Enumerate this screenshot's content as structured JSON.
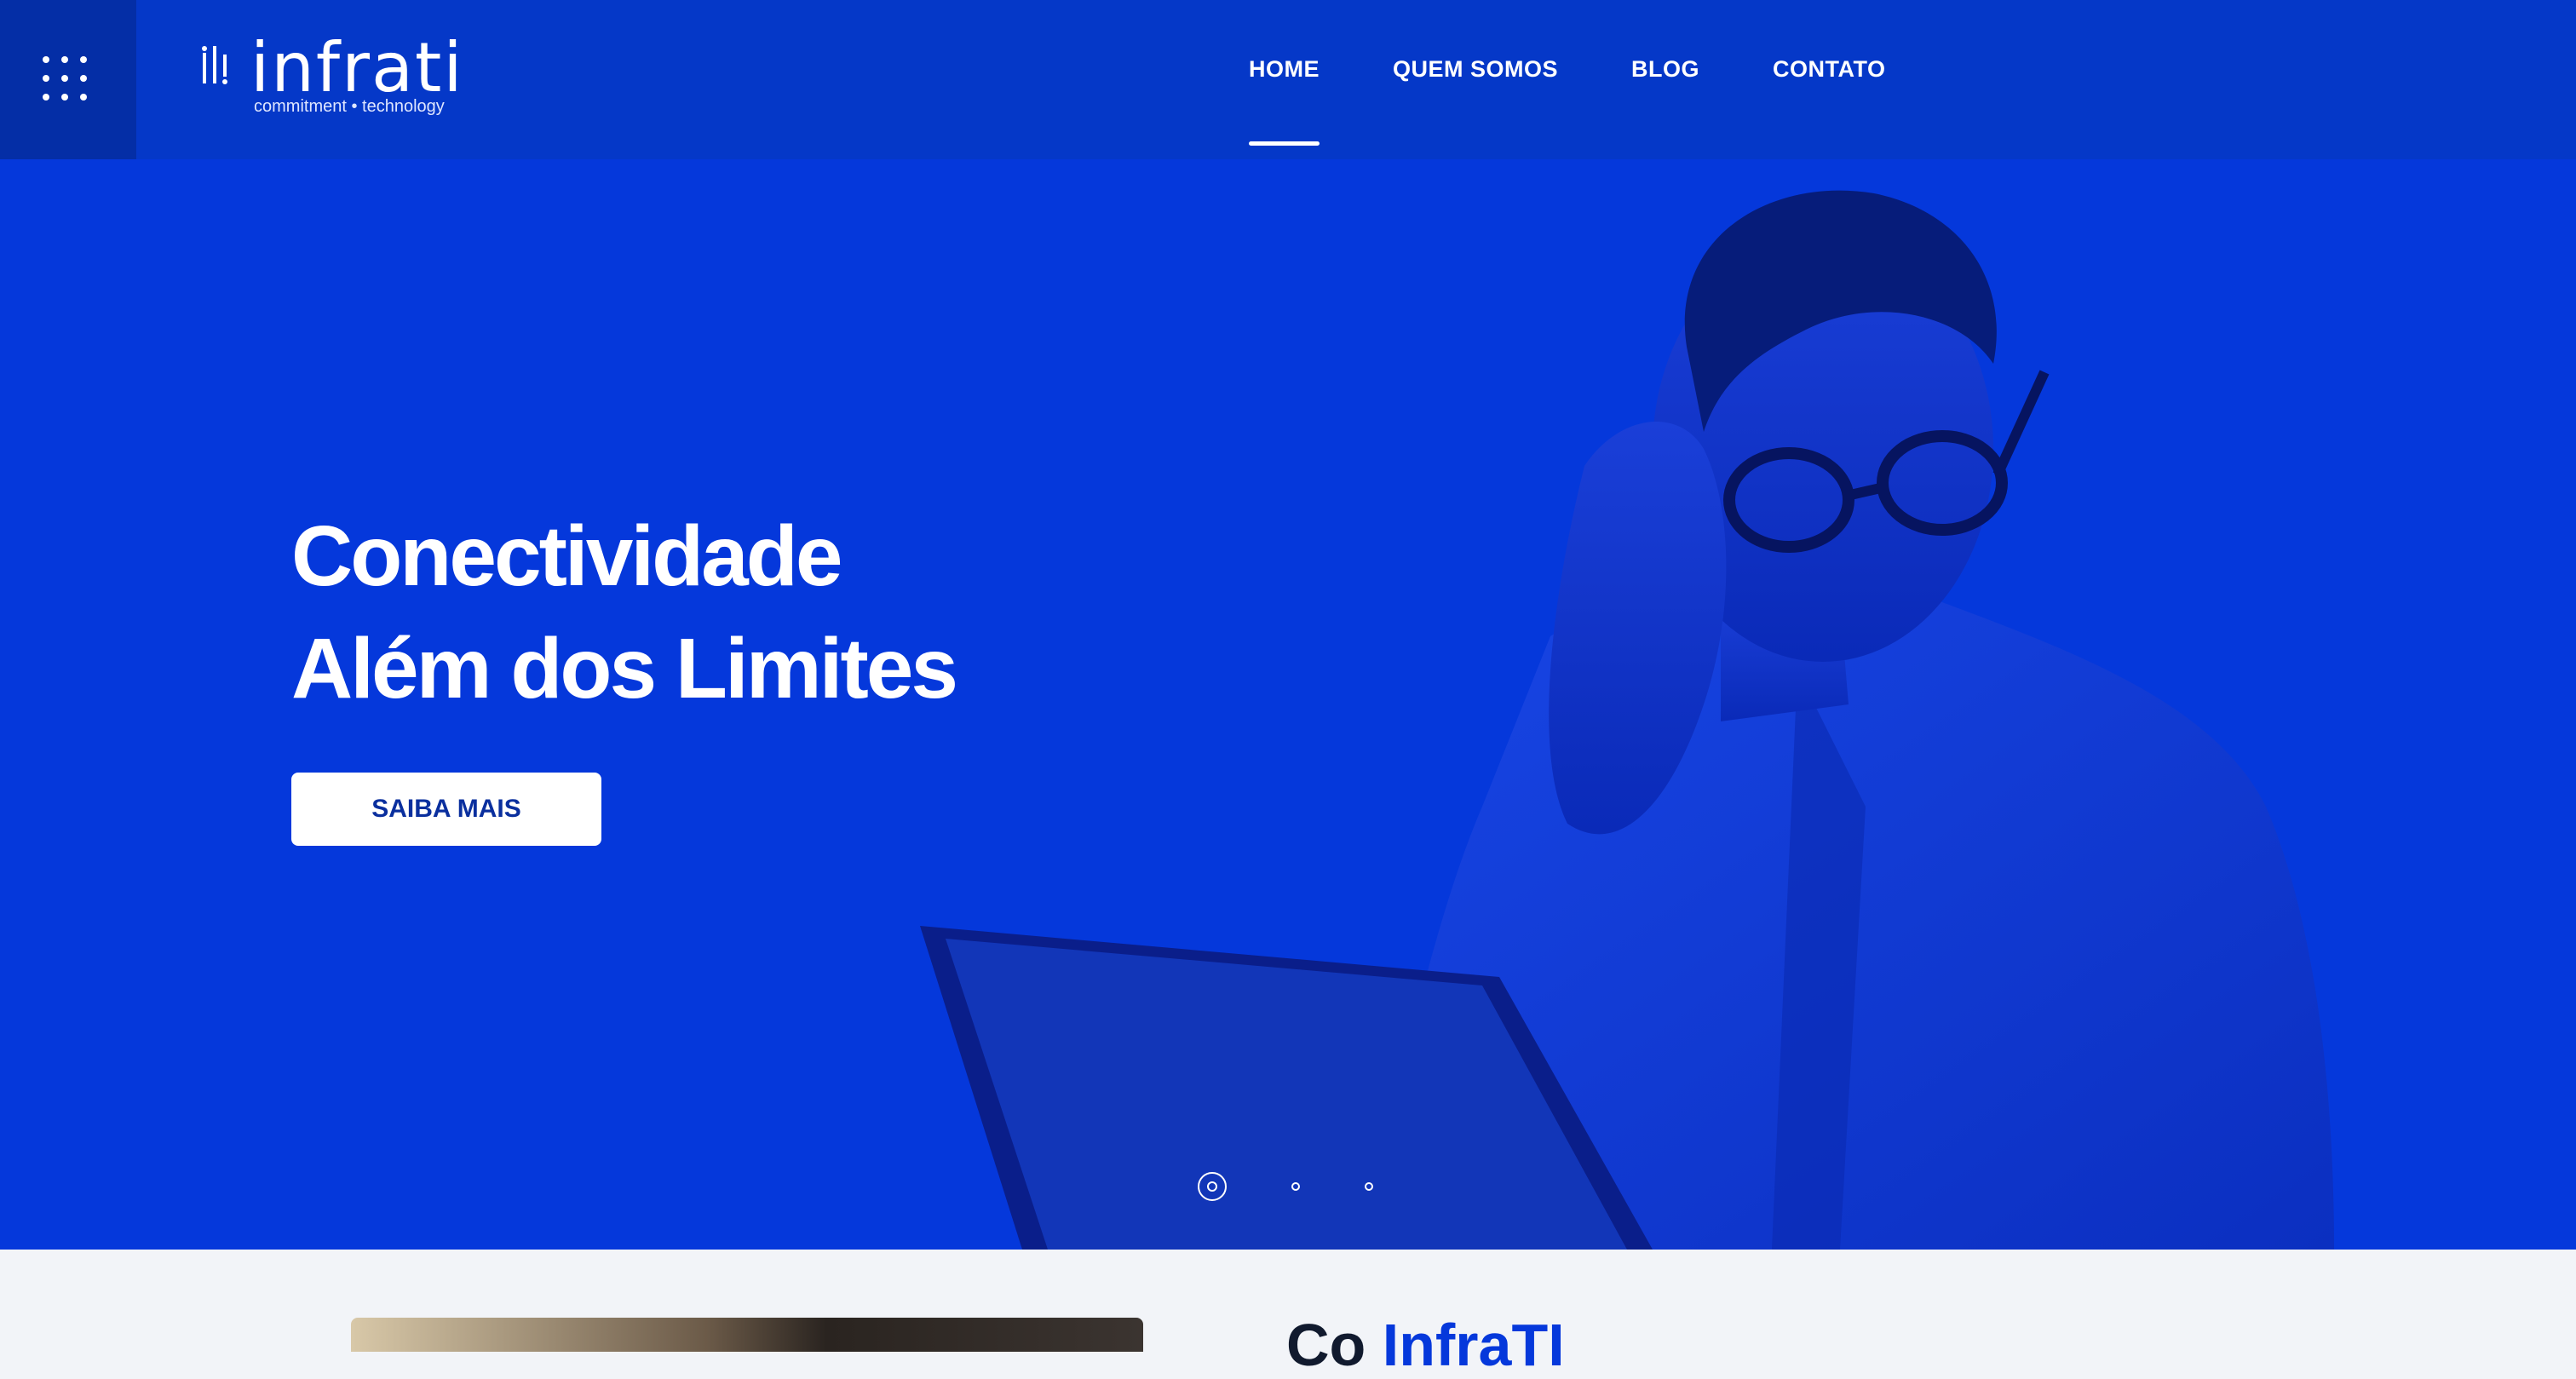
{
  "header": {
    "logo_text": "infrati",
    "logo_tagline": "commitment • technology",
    "menu_icon": "grid-dots-icon"
  },
  "nav": {
    "items": [
      {
        "label": "HOME",
        "active": true
      },
      {
        "label": "QUEM SOMOS",
        "active": false
      },
      {
        "label": "BLOG",
        "active": false
      },
      {
        "label": "CONTATO",
        "active": false
      }
    ]
  },
  "hero": {
    "headline_line1": "Conectividade",
    "headline_line2": "Além dos Limites",
    "cta_label": "SAIBA MAIS",
    "slides_count": 3,
    "active_slide": 1
  },
  "section": {
    "title_start": "Co",
    "title_brand": "InfraTI"
  },
  "colors": {
    "primary": "#0538db",
    "header": "#0538c8",
    "menu_box": "#042ea6",
    "section_bg": "#f2f4f8"
  }
}
